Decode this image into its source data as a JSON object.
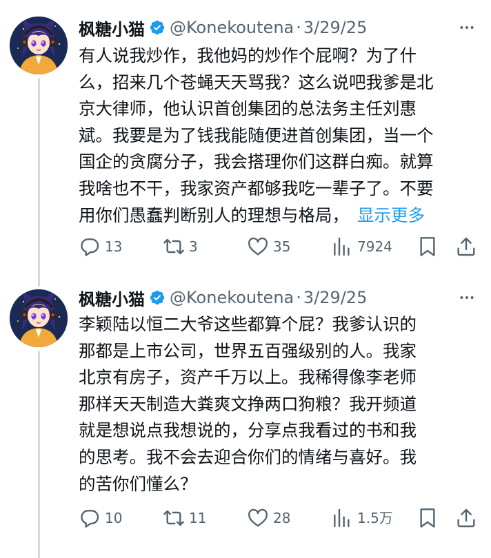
{
  "tweets": [
    {
      "author": {
        "name": "枫糖小猫",
        "handle": "@Konekoutena",
        "separator": "·",
        "date": "3/29/25"
      },
      "text": "有人说我炒作，我他妈的炒作个屁啊？为了什\n么，招来几个苍蝇天天骂我？这么说吧我爹是北\n京大律师，他认识首创集团的总法务主任刘惠\n斌。我要是为了钱我能随便进首创集团，当一个\n国企的贪腐分子，我会搭理你们这群白痴。就算\n我啥也不干，我家资产都够我吃一辈子了。不要\n用你们愚蠢判断别人的理想与格局，",
      "show_more": "显示更多",
      "stats": {
        "replies": "13",
        "retweets": "3",
        "likes": "35",
        "views": "7924"
      }
    },
    {
      "author": {
        "name": "枫糖小猫",
        "handle": "@Konekoutena",
        "separator": "·",
        "date": "3/29/25"
      },
      "text": "李颖陆以恒二大爷这些都算个屁？我爹认识的\n那都是上市公司，世界五百强级别的人。我家\n北京有房子，资产千万以上。我稀得像李老师\n那样天天制造大粪爽文挣两口狗粮？我开频道\n就是想说点我想说的，分享点我看过的书和我\n的思考。我不会去迎合你们的情绪与喜好。我\n的苦你们懂么？",
      "stats": {
        "replies": "10",
        "retweets": "11",
        "likes": "28",
        "views": "1.5万"
      }
    }
  ],
  "icons": {
    "avatar": "avatar-anime-girl-headphones",
    "verified": "verified-badge-icon",
    "more": "more-options-icon",
    "reply": "reply-icon",
    "retweet": "retweet-icon",
    "like": "like-icon",
    "views": "views-icon",
    "bookmark": "bookmark-icon",
    "share": "share-icon"
  },
  "colors": {
    "link": "#1d9bf0",
    "secondary": "#536471",
    "text": "#0f1419",
    "verified": "#1d9bf0",
    "thread_line": "#cfd9de"
  }
}
